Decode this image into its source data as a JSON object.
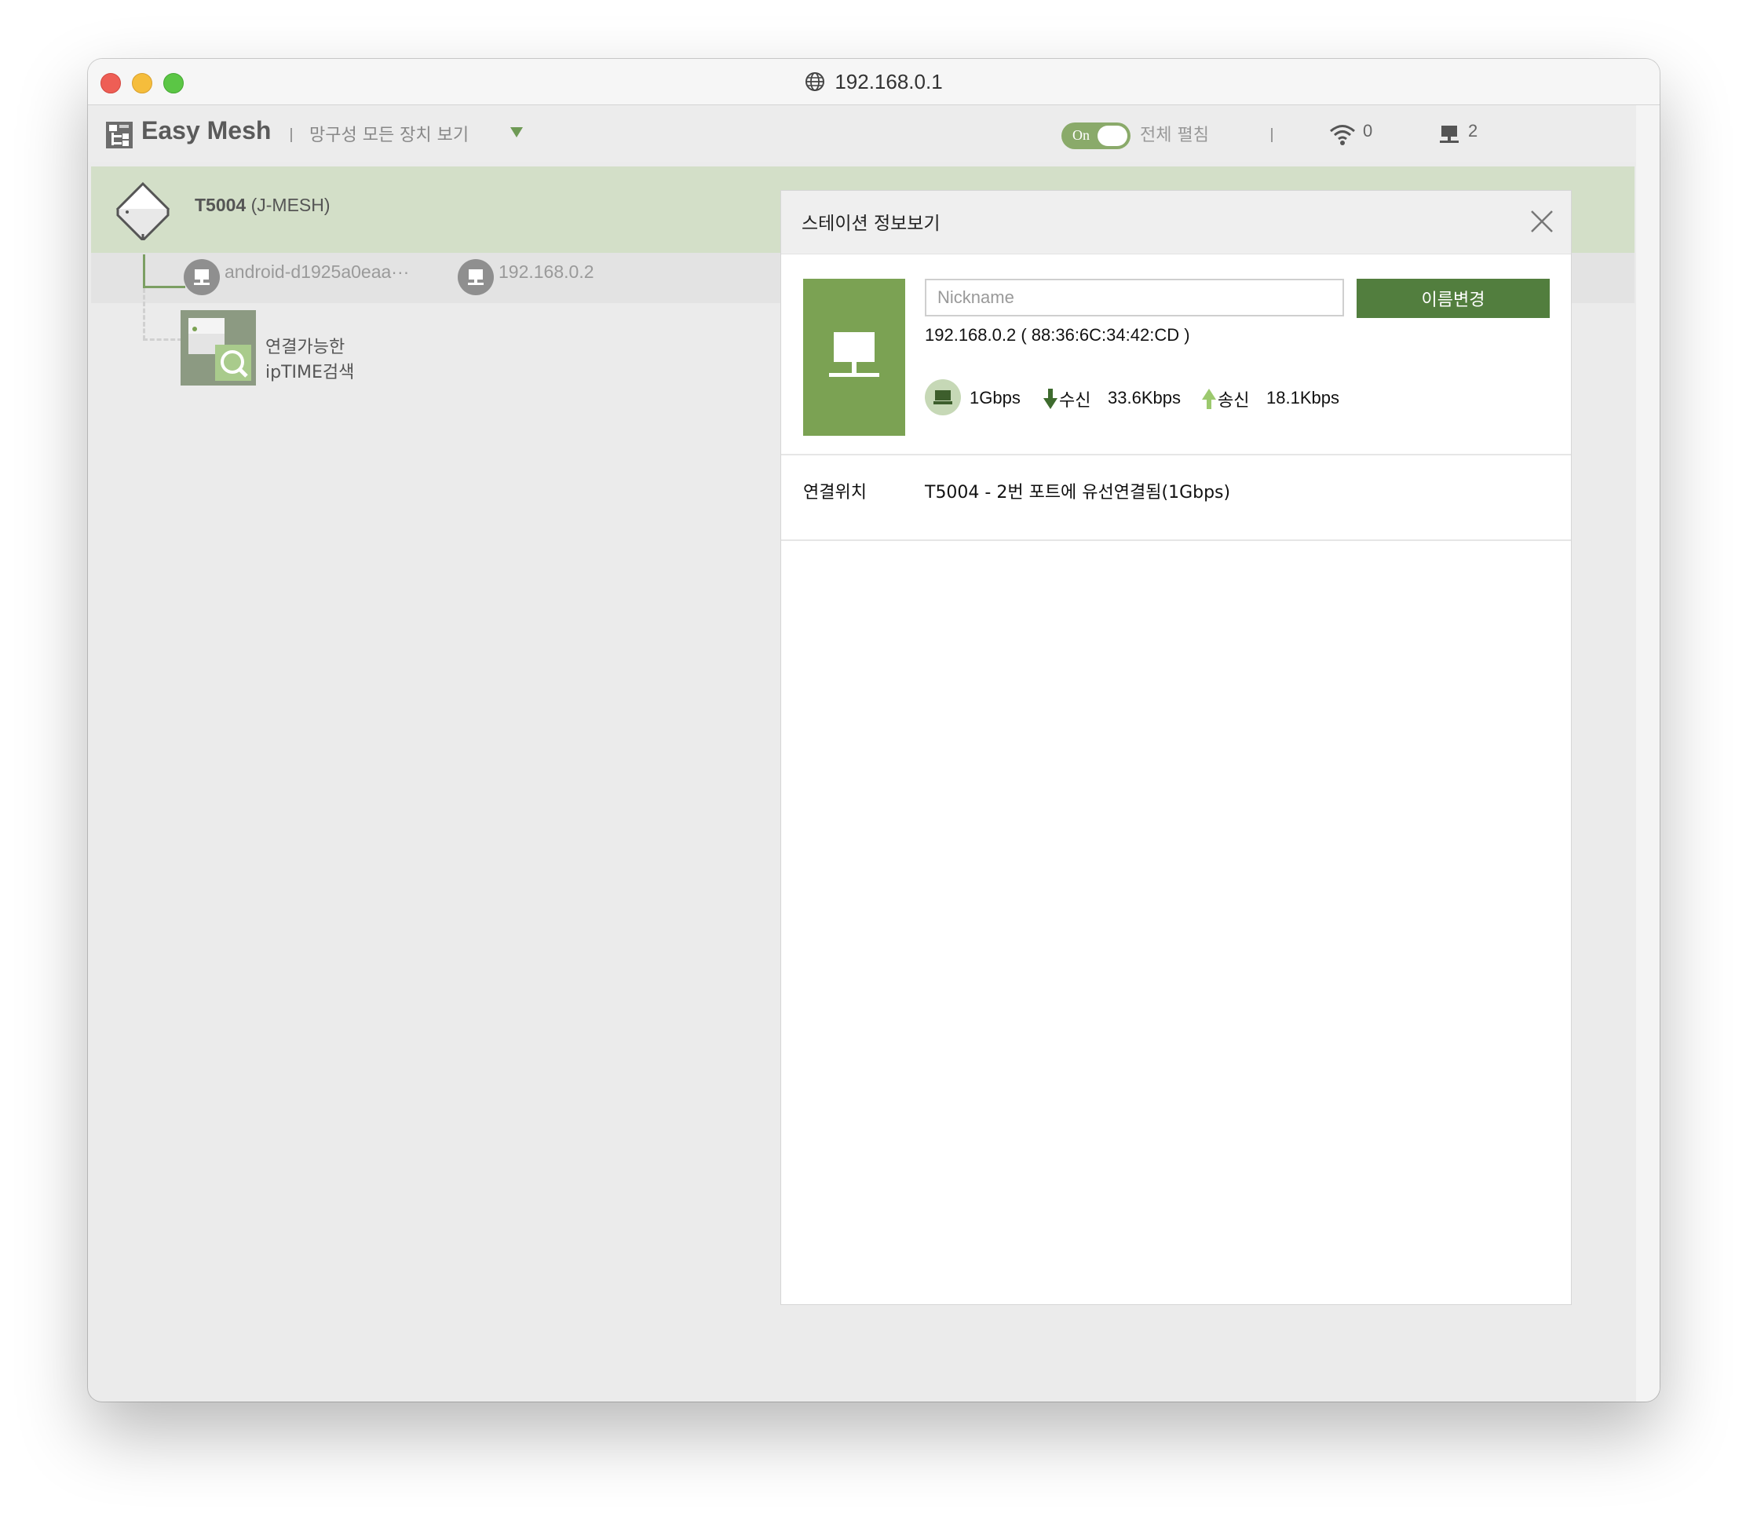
{
  "window": {
    "address": "192.168.0.1"
  },
  "header": {
    "app_title": "Easy Mesh",
    "view_select": "망구성 모든 장치 보기",
    "toggle_state": "On",
    "expand_all": "전체 펼침",
    "wifi_count": "0",
    "wired_count": "2"
  },
  "tree": {
    "router": {
      "model": "T5004",
      "name": "(J-MESH)"
    },
    "station": {
      "name": "android-d1925a0eaa···",
      "ip": "192.168.0.2"
    },
    "search": {
      "line1": "연결가능한",
      "line2": "ipTIME검색"
    }
  },
  "panel": {
    "title": "스테이션 정보보기",
    "nickname_placeholder": "Nickname",
    "nickname_value": "",
    "rename_button": "이름변경",
    "ip_mac": "192.168.0.2 ( 88:36:6C:34:42:CD )",
    "link_speed": "1Gbps",
    "rx_label": "수신",
    "rx_value": "33.6Kbps",
    "tx_label": "송신",
    "tx_value": "18.1Kbps",
    "connection_label": "연결위치",
    "connection_value": "T5004 - 2번 포트에 유선연결됨(1Gbps)"
  },
  "colors": {
    "accent_green": "#527e3e",
    "tile_green": "#7ba253",
    "router_row_bg": "#d3dfc8"
  },
  "icons": [
    "globe-icon",
    "logo-icon",
    "dropdown-caret-icon",
    "wifi-icon",
    "wired-icon",
    "router-icon",
    "monitor-icon",
    "search-icon",
    "close-icon",
    "down-arrow-icon",
    "up-arrow-icon"
  ]
}
